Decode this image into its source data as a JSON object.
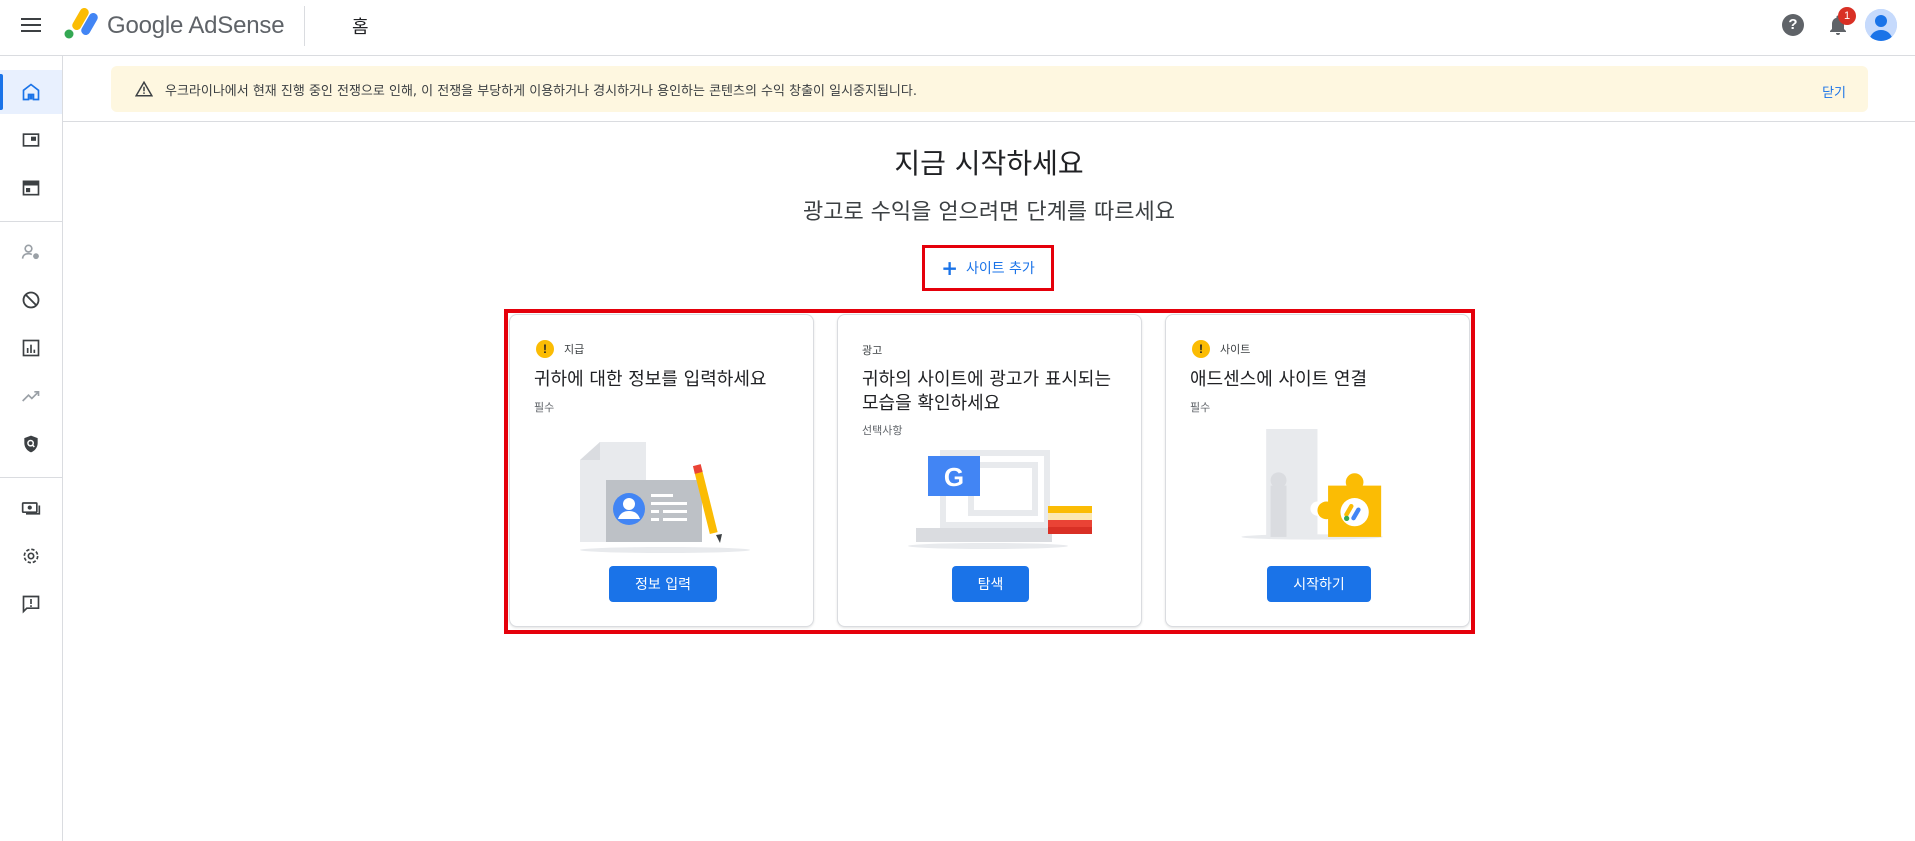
{
  "header": {
    "brand": "Google AdSense",
    "page_title": "홈",
    "notification_count": "1"
  },
  "sidebar": {
    "items": [
      {
        "icon": "home-icon",
        "active": true
      },
      {
        "icon": "ads-icon"
      },
      {
        "icon": "sites-icon"
      },
      {
        "icon": "privacy-messaging-icon"
      },
      {
        "icon": "blocking-controls-icon"
      },
      {
        "icon": "reports-icon"
      },
      {
        "icon": "optimization-icon"
      },
      {
        "icon": "policy-center-icon"
      },
      {
        "icon": "payments-icon"
      },
      {
        "icon": "settings-icon"
      },
      {
        "icon": "feedback-icon"
      }
    ]
  },
  "banner": {
    "text": "우크라이나에서 현재 진행 중인 전쟁으로 인해, 이 전쟁을 부당하게 이용하거나 경시하거나 용인하는 콘텐츠의 수익 창출이 일시중지됩니다.",
    "close_label": "닫기"
  },
  "hero": {
    "title": "지금 시작하세요",
    "subtitle": "광고로 수익을 얻으려면 단계를 따르세요"
  },
  "add_site": {
    "label": "사이트 추가"
  },
  "cards": [
    {
      "chip": "지급",
      "title": "귀하에 대한 정보를 입력하세요",
      "sub": "필수",
      "button": "정보 입력"
    },
    {
      "chip": "광고",
      "title": "귀하의 사이트에 광고가 표시되는 모습을 확인하세요",
      "sub": "선택사항",
      "button": "탐색"
    },
    {
      "chip": "사이트",
      "title": "애드센스에 사이트 연결",
      "sub": "필수",
      "button": "시작하기"
    }
  ],
  "colors": {
    "accent": "#1a73e8",
    "warning": "#fbbc04",
    "highlight": "#e5000b",
    "banner_bg": "#fef7e0"
  }
}
